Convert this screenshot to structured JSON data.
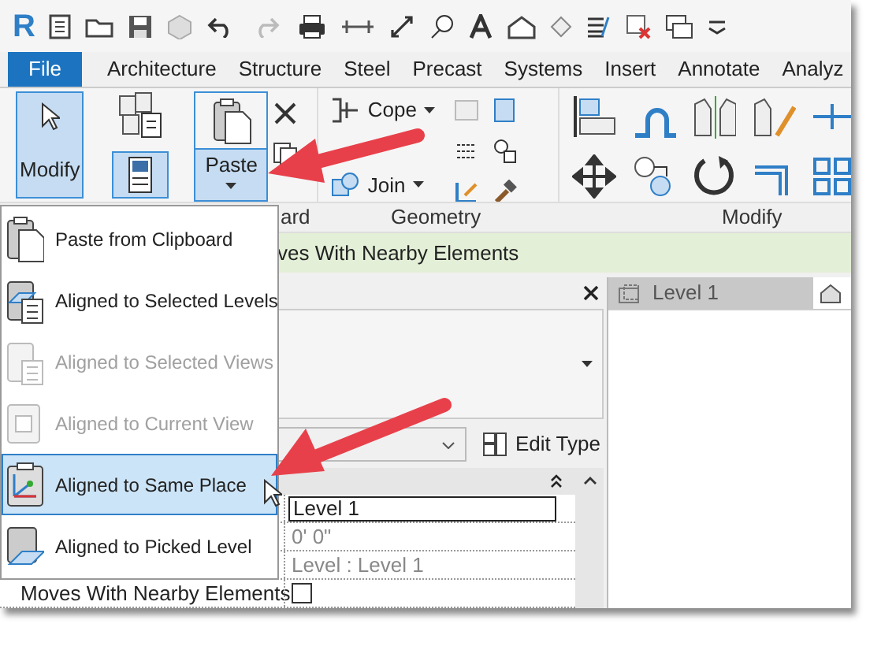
{
  "quick_access_toolbar": {
    "app_logo": "R"
  },
  "ribbon_tabs": [
    {
      "label": "File",
      "kind": "file"
    },
    {
      "label": "Architecture",
      "kind": "tab"
    },
    {
      "label": "Structure",
      "kind": "tab"
    },
    {
      "label": "Steel",
      "kind": "tab"
    },
    {
      "label": "Precast",
      "kind": "tab"
    },
    {
      "label": "Systems",
      "kind": "tab"
    },
    {
      "label": "Insert",
      "kind": "tab"
    },
    {
      "label": "Annotate",
      "kind": "tab"
    },
    {
      "label": "Analyz",
      "kind": "tab"
    }
  ],
  "ribbon": {
    "modify_button": {
      "label": "Modify",
      "selected": true
    },
    "properties_button": {
      "selected": true
    },
    "paste_button": {
      "label": "Paste",
      "selected": true
    },
    "cope_button": {
      "label": "Cope"
    },
    "join_button": {
      "label": "Join"
    },
    "panel_labels": [
      "ard",
      "Geometry",
      "Modify"
    ]
  },
  "options_bar": {
    "text": "ves With Nearby Elements"
  },
  "paste_menu": [
    {
      "label": "Paste from Clipboard",
      "disabled": false,
      "selected": false
    },
    {
      "label": "Aligned to Selected Levels",
      "disabled": false,
      "selected": false
    },
    {
      "label": "Aligned to Selected Views",
      "disabled": true,
      "selected": false
    },
    {
      "label": "Aligned to Current View",
      "disabled": true,
      "selected": false
    },
    {
      "label": "Aligned to Same Place",
      "disabled": false,
      "selected": true
    },
    {
      "label": "Aligned to Picked Level",
      "disabled": false,
      "selected": false
    }
  ],
  "properties": {
    "edit_type": "Edit Type",
    "rows": [
      {
        "kind": "field",
        "value": "Level 1"
      },
      {
        "kind": "text",
        "value": "0'  0\""
      },
      {
        "kind": "text",
        "value": "Level : Level 1"
      },
      {
        "kind": "checkbox",
        "label": "Moves With Nearby Elements",
        "checked": false
      }
    ]
  },
  "view_tab": {
    "label": "Level 1"
  }
}
